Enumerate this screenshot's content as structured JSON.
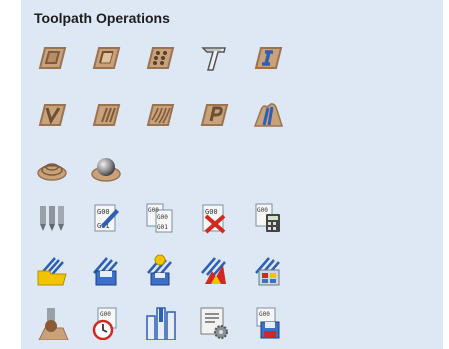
{
  "panel": {
    "title": "Toolpath Operations"
  },
  "tools": {
    "row1": [
      "profile-toolpath-icon",
      "pocket-toolpath-icon",
      "drilling-toolpath-icon",
      "quick-engrave-icon",
      "inlay-toolpath-icon"
    ],
    "row2": [
      "v-carve-toolpath-icon",
      "fluting-toolpath-icon",
      "texture-toolpath-icon",
      "prism-carving-icon",
      "moulding-toolpath-icon"
    ],
    "row3": [
      "3d-roughing-icon",
      "3d-finishing-icon"
    ],
    "row4": [
      "tool-database-icon",
      "edit-gcode-icon",
      "merge-toolpaths-icon",
      "delete-toolpath-icon",
      "toolpath-calculator-icon"
    ],
    "row5": [
      "open-toolpath-template-icon",
      "save-toolpath-template-icon",
      "apply-template-icon",
      "drag-knife-icon",
      "toolpath-tiling-icon"
    ],
    "row6": [
      "preview-material-icon",
      "machining-time-icon",
      "toolpath-summary-icon",
      "toolpath-settings-icon",
      "save-toolpath-icon"
    ]
  },
  "colors": {
    "panel_bg": "#dde8f4",
    "wood": "#c9a27a",
    "wood_dark": "#9a7352",
    "blue": "#2f5fb3",
    "yellow": "#f2c400",
    "red": "#d2281f"
  }
}
